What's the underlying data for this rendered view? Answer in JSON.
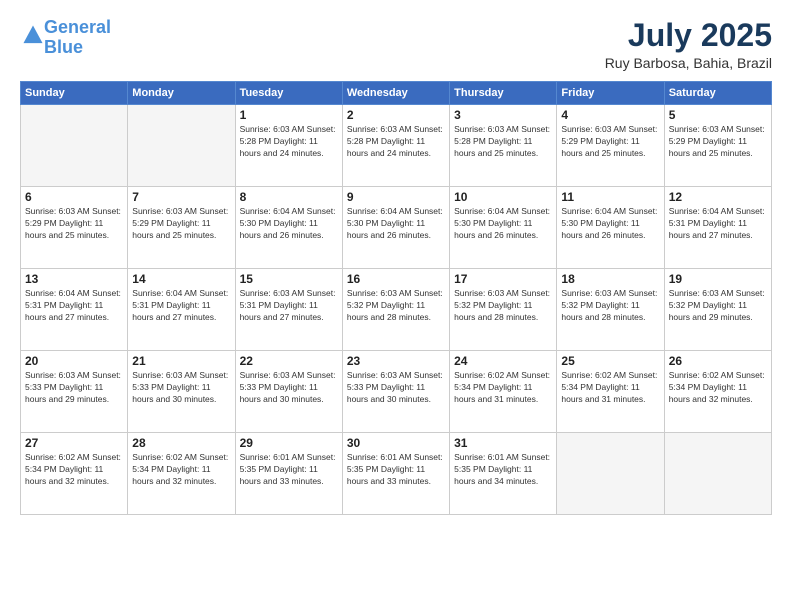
{
  "logo": {
    "line1": "General",
    "line2": "Blue"
  },
  "header": {
    "month": "July 2025",
    "location": "Ruy Barbosa, Bahia, Brazil"
  },
  "weekdays": [
    "Sunday",
    "Monday",
    "Tuesday",
    "Wednesday",
    "Thursday",
    "Friday",
    "Saturday"
  ],
  "weeks": [
    [
      {
        "day": "",
        "info": ""
      },
      {
        "day": "",
        "info": ""
      },
      {
        "day": "1",
        "info": "Sunrise: 6:03 AM\nSunset: 5:28 PM\nDaylight: 11 hours and 24 minutes."
      },
      {
        "day": "2",
        "info": "Sunrise: 6:03 AM\nSunset: 5:28 PM\nDaylight: 11 hours and 24 minutes."
      },
      {
        "day": "3",
        "info": "Sunrise: 6:03 AM\nSunset: 5:28 PM\nDaylight: 11 hours and 25 minutes."
      },
      {
        "day": "4",
        "info": "Sunrise: 6:03 AM\nSunset: 5:29 PM\nDaylight: 11 hours and 25 minutes."
      },
      {
        "day": "5",
        "info": "Sunrise: 6:03 AM\nSunset: 5:29 PM\nDaylight: 11 hours and 25 minutes."
      }
    ],
    [
      {
        "day": "6",
        "info": "Sunrise: 6:03 AM\nSunset: 5:29 PM\nDaylight: 11 hours and 25 minutes."
      },
      {
        "day": "7",
        "info": "Sunrise: 6:03 AM\nSunset: 5:29 PM\nDaylight: 11 hours and 25 minutes."
      },
      {
        "day": "8",
        "info": "Sunrise: 6:04 AM\nSunset: 5:30 PM\nDaylight: 11 hours and 26 minutes."
      },
      {
        "day": "9",
        "info": "Sunrise: 6:04 AM\nSunset: 5:30 PM\nDaylight: 11 hours and 26 minutes."
      },
      {
        "day": "10",
        "info": "Sunrise: 6:04 AM\nSunset: 5:30 PM\nDaylight: 11 hours and 26 minutes."
      },
      {
        "day": "11",
        "info": "Sunrise: 6:04 AM\nSunset: 5:30 PM\nDaylight: 11 hours and 26 minutes."
      },
      {
        "day": "12",
        "info": "Sunrise: 6:04 AM\nSunset: 5:31 PM\nDaylight: 11 hours and 27 minutes."
      }
    ],
    [
      {
        "day": "13",
        "info": "Sunrise: 6:04 AM\nSunset: 5:31 PM\nDaylight: 11 hours and 27 minutes."
      },
      {
        "day": "14",
        "info": "Sunrise: 6:04 AM\nSunset: 5:31 PM\nDaylight: 11 hours and 27 minutes."
      },
      {
        "day": "15",
        "info": "Sunrise: 6:03 AM\nSunset: 5:31 PM\nDaylight: 11 hours and 27 minutes."
      },
      {
        "day": "16",
        "info": "Sunrise: 6:03 AM\nSunset: 5:32 PM\nDaylight: 11 hours and 28 minutes."
      },
      {
        "day": "17",
        "info": "Sunrise: 6:03 AM\nSunset: 5:32 PM\nDaylight: 11 hours and 28 minutes."
      },
      {
        "day": "18",
        "info": "Sunrise: 6:03 AM\nSunset: 5:32 PM\nDaylight: 11 hours and 28 minutes."
      },
      {
        "day": "19",
        "info": "Sunrise: 6:03 AM\nSunset: 5:32 PM\nDaylight: 11 hours and 29 minutes."
      }
    ],
    [
      {
        "day": "20",
        "info": "Sunrise: 6:03 AM\nSunset: 5:33 PM\nDaylight: 11 hours and 29 minutes."
      },
      {
        "day": "21",
        "info": "Sunrise: 6:03 AM\nSunset: 5:33 PM\nDaylight: 11 hours and 30 minutes."
      },
      {
        "day": "22",
        "info": "Sunrise: 6:03 AM\nSunset: 5:33 PM\nDaylight: 11 hours and 30 minutes."
      },
      {
        "day": "23",
        "info": "Sunrise: 6:03 AM\nSunset: 5:33 PM\nDaylight: 11 hours and 30 minutes."
      },
      {
        "day": "24",
        "info": "Sunrise: 6:02 AM\nSunset: 5:34 PM\nDaylight: 11 hours and 31 minutes."
      },
      {
        "day": "25",
        "info": "Sunrise: 6:02 AM\nSunset: 5:34 PM\nDaylight: 11 hours and 31 minutes."
      },
      {
        "day": "26",
        "info": "Sunrise: 6:02 AM\nSunset: 5:34 PM\nDaylight: 11 hours and 32 minutes."
      }
    ],
    [
      {
        "day": "27",
        "info": "Sunrise: 6:02 AM\nSunset: 5:34 PM\nDaylight: 11 hours and 32 minutes."
      },
      {
        "day": "28",
        "info": "Sunrise: 6:02 AM\nSunset: 5:34 PM\nDaylight: 11 hours and 32 minutes."
      },
      {
        "day": "29",
        "info": "Sunrise: 6:01 AM\nSunset: 5:35 PM\nDaylight: 11 hours and 33 minutes."
      },
      {
        "day": "30",
        "info": "Sunrise: 6:01 AM\nSunset: 5:35 PM\nDaylight: 11 hours and 33 minutes."
      },
      {
        "day": "31",
        "info": "Sunrise: 6:01 AM\nSunset: 5:35 PM\nDaylight: 11 hours and 34 minutes."
      },
      {
        "day": "",
        "info": ""
      },
      {
        "day": "",
        "info": ""
      }
    ]
  ]
}
